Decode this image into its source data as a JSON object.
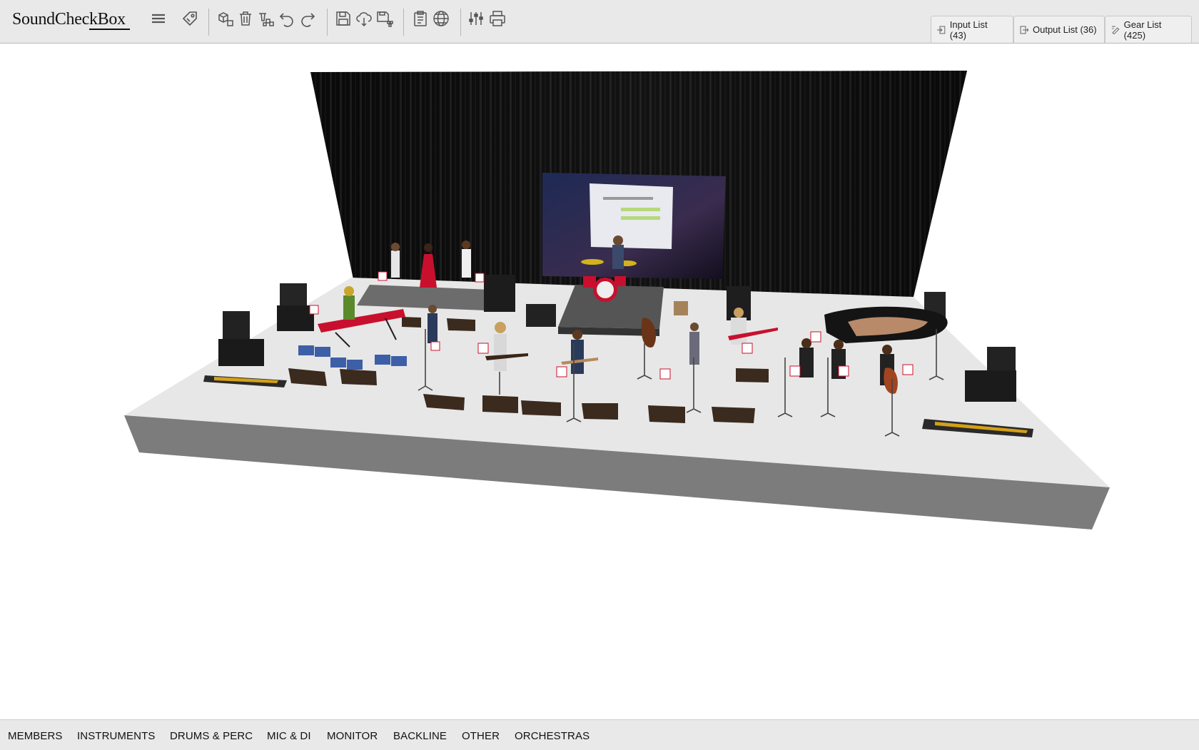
{
  "app": {
    "name": "SoundCheckBox"
  },
  "toolbar": {
    "icons": [
      "menu-icon",
      "tag-icon",
      "add-element-icon",
      "delete-icon",
      "delete-all-icon",
      "undo-icon",
      "redo-icon",
      "save-icon",
      "cloud-upload-icon",
      "save-as-icon",
      "clipboard-icon",
      "globe-icon",
      "mixer-icon",
      "print-icon"
    ]
  },
  "tabs": {
    "input_list": "Input List (43)",
    "output_list": "Output List (36)",
    "gear_list": "Gear List (425)"
  },
  "categories": [
    "MEMBERS",
    "INSTRUMENTS",
    "DRUMS & PERC",
    "MIC & DI",
    "MONITOR",
    "BACKLINE",
    "OTHER",
    "ORCHESTRAS"
  ],
  "colors": {
    "stage_top": "#e7e7e7",
    "stage_front": "#7c7c7c",
    "curtain": "#0d0d0d",
    "monitor": "#3b2a1e",
    "accent_red": "#c8102e",
    "toolbar_bg": "#e9e9e9"
  }
}
